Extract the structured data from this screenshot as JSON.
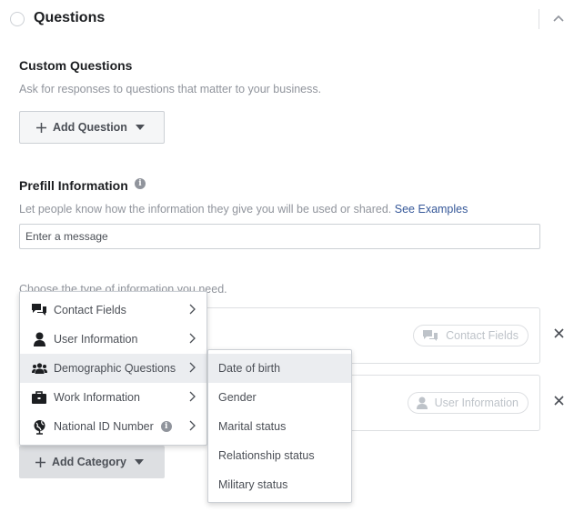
{
  "header": {
    "title": "Questions"
  },
  "custom_questions": {
    "title": "Custom Questions",
    "description": "Ask for responses to questions that matter to your business.",
    "add_button": "Add Question"
  },
  "prefill": {
    "title": "Prefill Information",
    "description": "Let people know how the information they give you will be used or shared.",
    "link": "See Examples",
    "input_placeholder": "Enter a message",
    "choose_label": "Choose the type of information you need."
  },
  "categories": [
    {
      "pill_label": "Contact Fields",
      "pill_icon": "chat-bubbles-icon"
    },
    {
      "pill_label": "User Information",
      "pill_icon": "person-icon"
    }
  ],
  "add_category_button": "Add Category",
  "menu": {
    "items": [
      {
        "label": "Contact Fields",
        "icon": "chat-bubbles-icon"
      },
      {
        "label": "User Information",
        "icon": "person-icon"
      },
      {
        "label": "Demographic Questions",
        "icon": "group-icon",
        "active": true
      },
      {
        "label": "Work Information",
        "icon": "briefcase-icon"
      },
      {
        "label": "National ID Number",
        "icon": "globe-icon",
        "info": true
      }
    ]
  },
  "submenu": {
    "items": [
      {
        "label": "Date of birth",
        "active": true
      },
      {
        "label": "Gender"
      },
      {
        "label": "Marital status"
      },
      {
        "label": "Relationship status"
      },
      {
        "label": "Military status"
      }
    ]
  },
  "colors": {
    "link": "#365899",
    "muted_text": "#90949c",
    "button_bg": "#f5f6f7",
    "border": "#ccd0d5"
  }
}
